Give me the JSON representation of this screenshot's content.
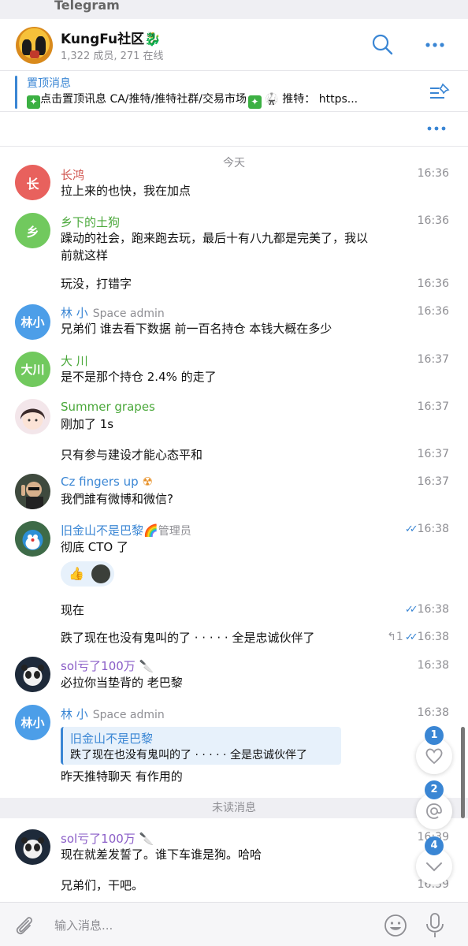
{
  "app": {
    "title": "Telegram"
  },
  "header": {
    "name": "KungFu社区",
    "name_emoji": "🐉",
    "subtitle": "1,322 成员, 271 在线"
  },
  "pinned": {
    "title": "置顶消息",
    "text": "点击置顶讯息 CA/推特/推特社群/交易市场",
    "spark": "✦",
    "text2": "🥋 推特：  https..."
  },
  "date_separator": "今天",
  "messages": [
    {
      "avatar_letter": "长",
      "avatar_color": "#e8615d",
      "name": "长鸿",
      "name_color": "#d0554f",
      "text": "拉上来的也快，我在加点",
      "time": "16:36"
    },
    {
      "avatar_letter": "乡",
      "avatar_color": "#71c95e",
      "name": "乡下的土狗",
      "name_color": "#4aa83a",
      "text_line1": "躁动的社会，跑来跑去玩，最后十有八九都是完美了，我以",
      "text_line2": "前就这样",
      "time": "16:36"
    },
    {
      "text": "玩没，打错字",
      "time": "16:36"
    },
    {
      "avatar_letter": "林小",
      "avatar_color": "#4c9ee8",
      "name": "林 小",
      "name_color": "#3a86d4",
      "role": "Space admin",
      "text": "兄弟们 谁去看下数据 前一百名持仓 本钱大概在多少",
      "time": "16:36"
    },
    {
      "avatar_letter": "大川",
      "avatar_color": "#71c95e",
      "name": "大 川",
      "name_color": "#4aa83a",
      "text": "是不是那个持仓 2.4% 的走了",
      "time": "16:37"
    },
    {
      "name": "Summer grapes",
      "name_color": "#4aa83a",
      "text": "刚加了 1s",
      "time": "16:37"
    },
    {
      "text": "只有参与建设才能心态平和",
      "time": "16:37"
    },
    {
      "name": "Cz fingers up",
      "name_emoji": "☢",
      "name_color": "#3a86d4",
      "text": "我們誰有微博和微信?",
      "time": "16:37"
    },
    {
      "name": "旧金山不是巴黎",
      "name_emoji": "🌈",
      "name_color": "#3a86d4",
      "role": "管理员",
      "text": "彻底 CTO 了",
      "time": "16:38",
      "ticks": "✓✓",
      "reaction_emoji": "👍"
    },
    {
      "text": "现在",
      "time": "16:38",
      "ticks": "✓✓"
    },
    {
      "text": "跌了现在也没有鬼叫的了 · · · · · 全是忠诚伙伴了",
      "time": "16:38",
      "reply_icon": "↰",
      "reply_count": "1",
      "ticks": "✓✓"
    },
    {
      "name": "sol亏了100万",
      "name_emoji": "🔪",
      "name_color": "#8a5dc7",
      "text": "必拉你当垫背的 老巴黎",
      "time": "16:38"
    },
    {
      "avatar_letter": "林小",
      "avatar_color": "#4c9ee8",
      "name": "林 小",
      "name_color": "#3a86d4",
      "role": "Space admin",
      "reply_name": "旧金山不是巴黎",
      "reply_text": "跌了现在也没有鬼叫的了 · · · · · 全是忠诚伙伴了",
      "text": "昨天推特聊天 有作用的",
      "time": "16:38"
    },
    {
      "name": "sol亏了100万",
      "name_emoji": "🔪",
      "name_color": "#8a5dc7",
      "text": "现在就差发誓了。谁下车谁是狗。哈哈",
      "time": "16:39"
    },
    {
      "text": "兄弟们，干吧。",
      "time": "16:39"
    }
  ],
  "unread_label": "未读消息",
  "floating": [
    {
      "badge": "1",
      "icon": "heart-icon"
    },
    {
      "badge": "2",
      "icon": "at-icon"
    },
    {
      "badge": "4",
      "icon": "chevron-down-icon"
    }
  ],
  "composer": {
    "placeholder": "输入消息..."
  },
  "colors": {
    "accent": "#3a86d4"
  }
}
